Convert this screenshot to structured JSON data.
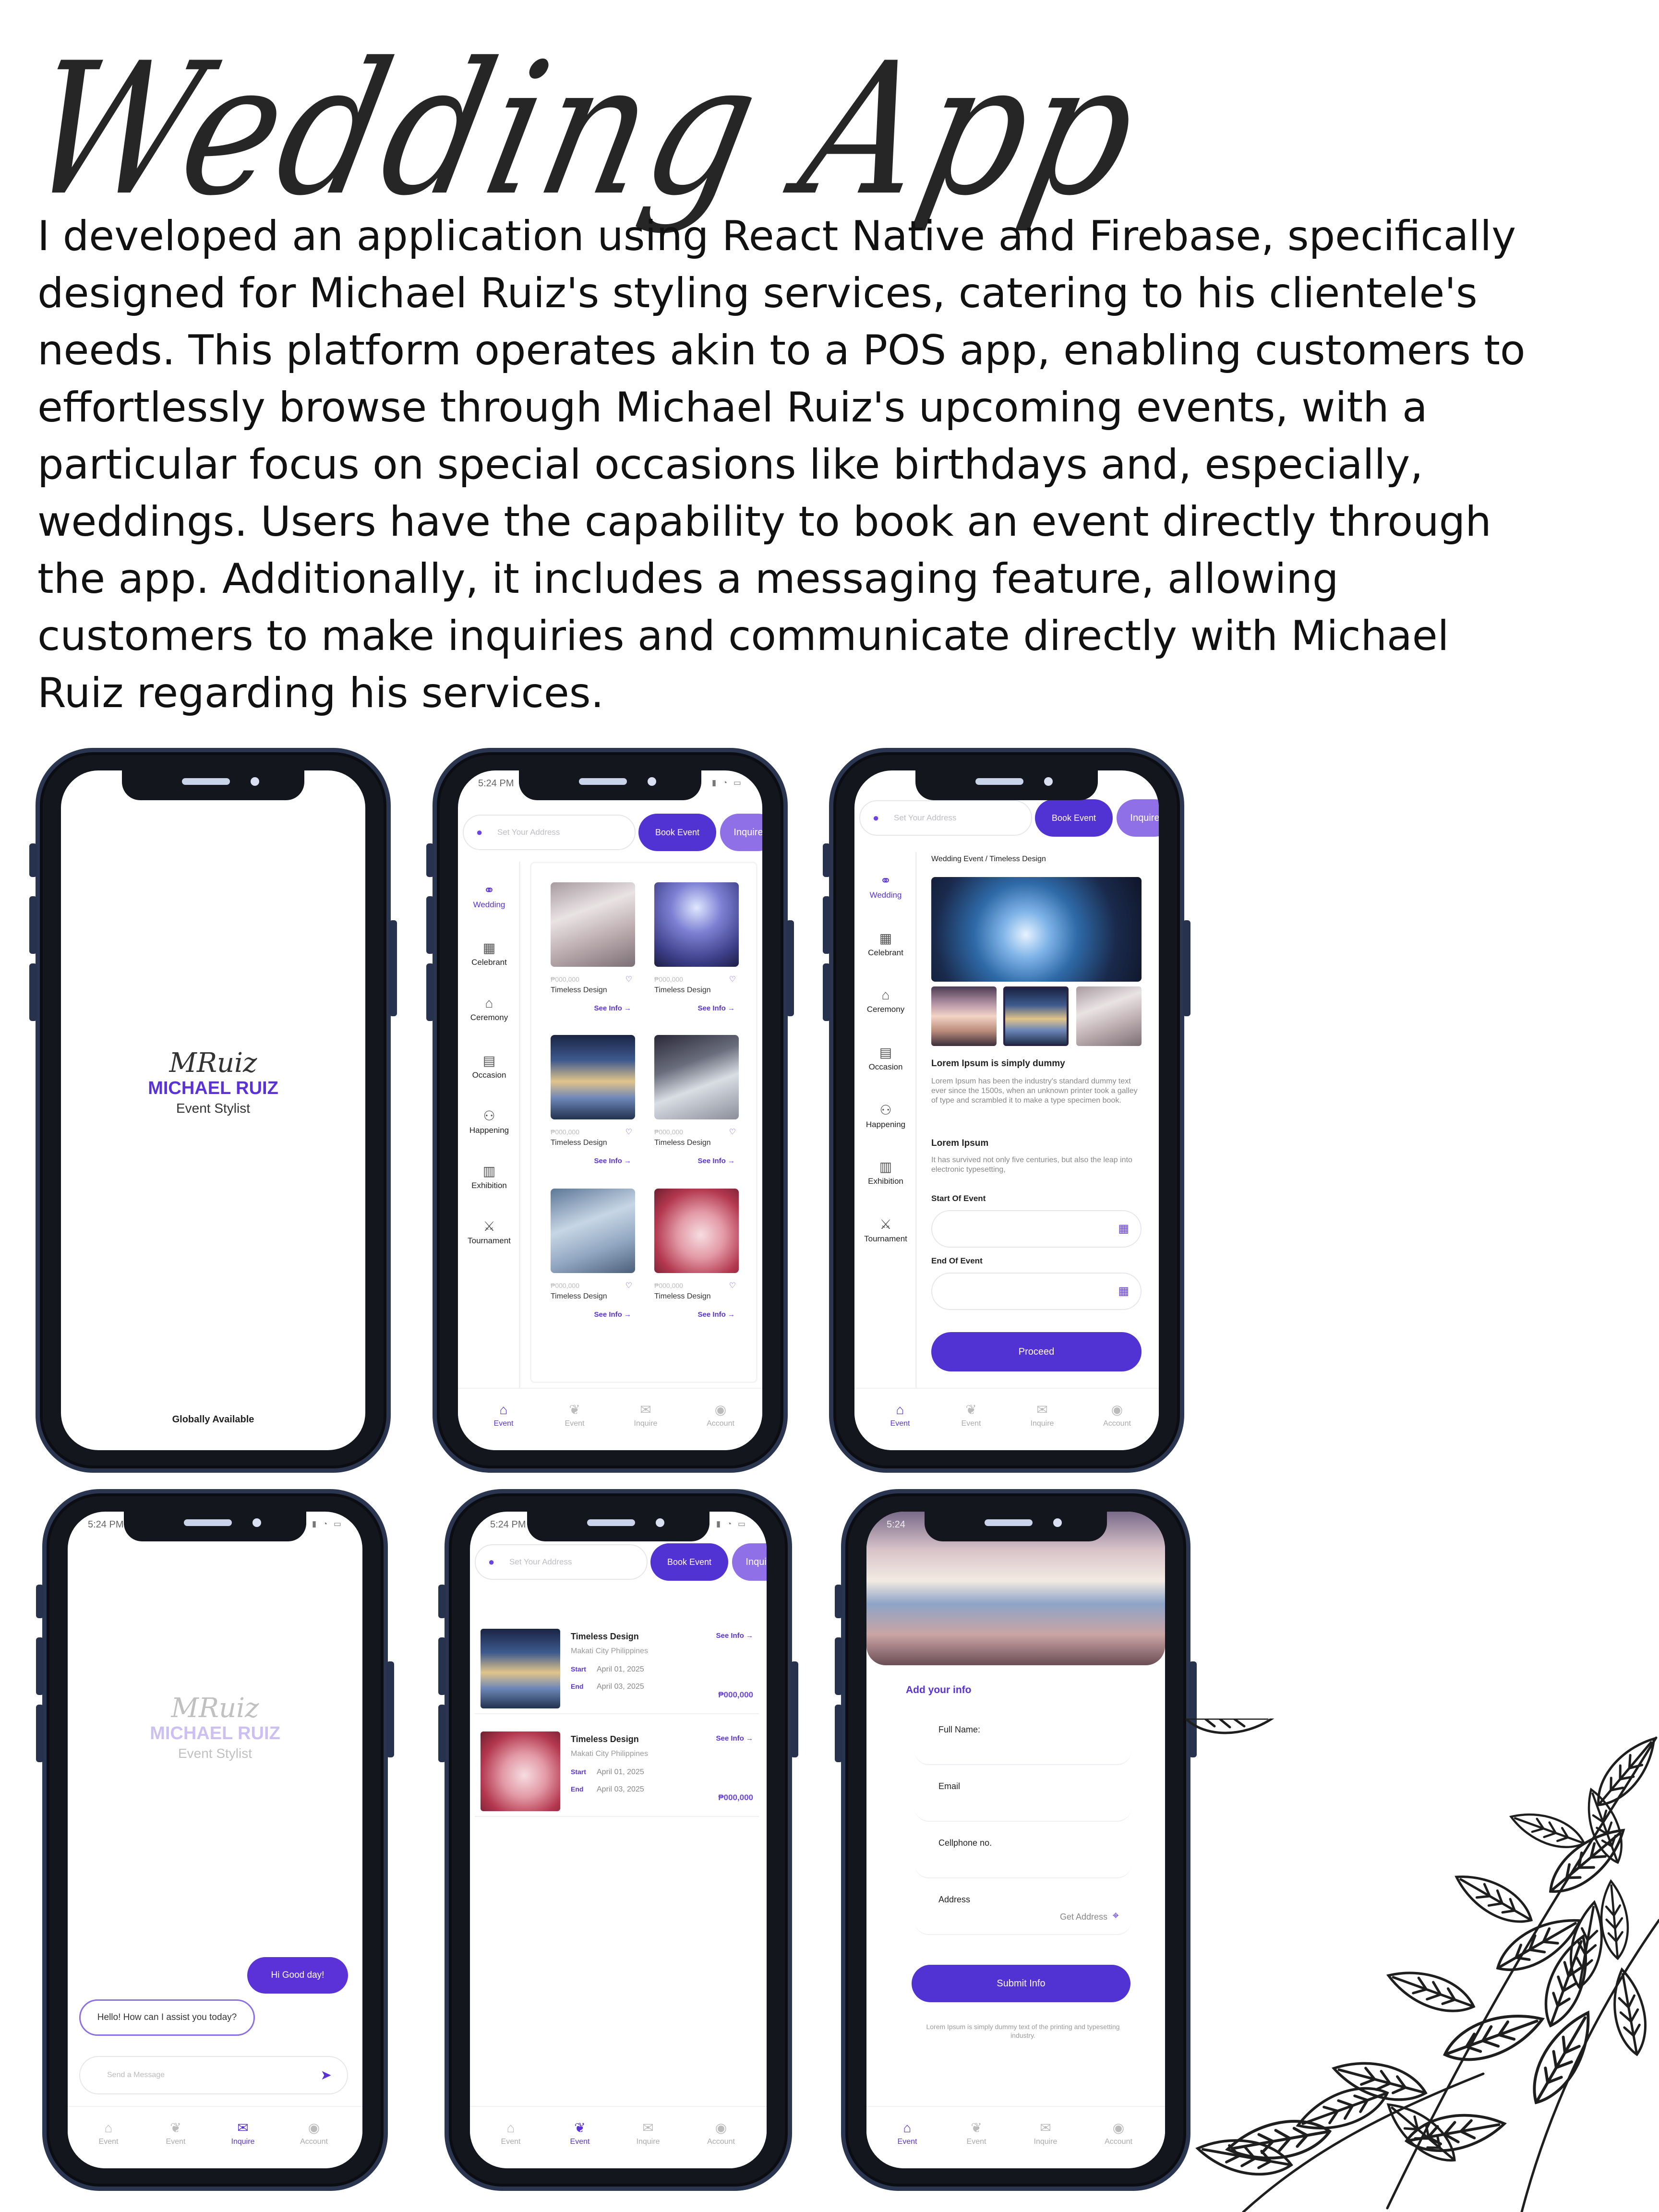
{
  "header": {
    "title": "Wedding App",
    "description": "I developed an application using React Native and Firebase, specifically designed for Michael Ruiz's styling services, catering to his clientele's needs. This platform operates akin to a POS app, enabling customers to effortlessly browse through Michael Ruiz's upcoming events, with a particular focus on special occasions like birthdays and, especially, weddings. Users have the capability to book an event directly through the app. Additionally, it includes a messaging feature, allowing customers to make inquiries and communicate directly with Michael Ruiz regarding his services."
  },
  "status": {
    "time": "5:24 PM",
    "time_short": "5:24"
  },
  "logo": {
    "script": "MRuiz",
    "brand": "MICHAEL RUIZ",
    "subtitle": "Event Stylist"
  },
  "splash": {
    "footer": "Globally Available"
  },
  "search": {
    "placeholder": "Set Your Address",
    "book_label": "Book Event",
    "inquire_label": "Inquire"
  },
  "categories": [
    {
      "label": "Wedding",
      "icon": "rings-icon"
    },
    {
      "label": "Celebrant",
      "icon": "cake-icon"
    },
    {
      "label": "Ceremony",
      "icon": "arch-icon"
    },
    {
      "label": "Occasion",
      "icon": "calendar-icon"
    },
    {
      "label": "Happening",
      "icon": "people-icon"
    },
    {
      "label": "Exhibition",
      "icon": "booth-icon"
    },
    {
      "label": "Tournament",
      "icon": "trophy-icon"
    }
  ],
  "products": [
    {
      "price": "₱000,000",
      "name": "Timeless Design",
      "more": "See Info"
    },
    {
      "price": "₱000,000",
      "name": "Timeless Design",
      "more": "See Info"
    },
    {
      "price": "₱000,000",
      "name": "Timeless Design",
      "more": "See Info"
    },
    {
      "price": "₱000,000",
      "name": "Timeless Design",
      "more": "See Info"
    },
    {
      "price": "₱000,000",
      "name": "Timeless Design",
      "more": "See Info"
    },
    {
      "price": "₱000,000",
      "name": "Timeless Design",
      "more": "See Info"
    }
  ],
  "tabs": [
    {
      "label": "Event",
      "icon": "home-icon"
    },
    {
      "label": "Event",
      "icon": "leaf-icon"
    },
    {
      "label": "Inquire",
      "icon": "mail-icon"
    },
    {
      "label": "Account",
      "icon": "account-icon"
    }
  ],
  "detail": {
    "breadcrumb": "Wedding Event / Timeless Design",
    "heading1": "Lorem Ipsum is simply dummy",
    "para1": "Lorem Ipsum has been the industry's standard dummy text ever since the 1500s, when an unknown printer took a galley of type and scrambled it to make a type specimen book.",
    "heading2": "Lorem Ipsum",
    "para2": "It has survived not only five centuries, but also the leap into electronic typesetting,",
    "start_label": "Start Of Event",
    "end_label": "End Of Event",
    "proceed_label": "Proceed"
  },
  "chat": {
    "outgoing": "Hi Good day!",
    "incoming": "Hello! How can I assist you today?",
    "placeholder": "Send a Message"
  },
  "events": [
    {
      "title": "Timeless Design",
      "location": "Makati City Philippines",
      "start_label": "Start",
      "start": "April 01, 2025",
      "end_label": "End",
      "end": "April 03, 2025",
      "more": "See Info",
      "price": "₱000,000"
    },
    {
      "title": "Timeless Design",
      "location": "Makati City Philippines",
      "start_label": "Start",
      "start": "April 01, 2025",
      "end_label": "End",
      "end": "April 03, 2025",
      "more": "See Info",
      "price": "₱000,000"
    }
  ],
  "form": {
    "title": "Add your info",
    "full_name": "Full Name:",
    "email": "Email",
    "cellphone": "Cellphone no.",
    "address": "Address",
    "get_address": "Get Address",
    "submit": "Submit Info",
    "note": "Lorem Ipsum is simply dummy text of the printing and typesetting industry."
  },
  "colors": {
    "accent": "#5132d2",
    "accent_light": "#8f70e6",
    "phone_body": "#14161d"
  }
}
